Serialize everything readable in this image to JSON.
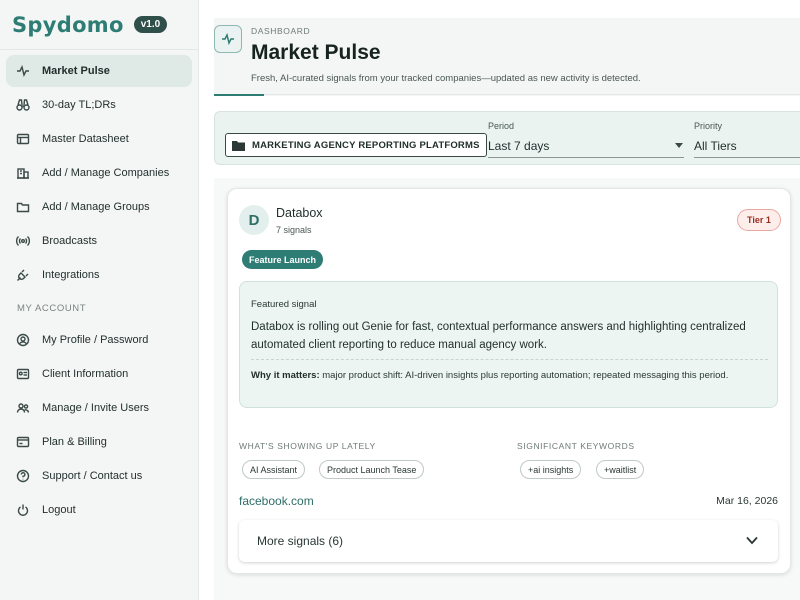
{
  "brand": {
    "name": "Spydomo",
    "version": "v1.0"
  },
  "sidebar": {
    "items": [
      {
        "label": "Market Pulse",
        "icon": "pulse-icon",
        "active": true
      },
      {
        "label": "30-day TL;DRs",
        "icon": "binoculars-icon"
      },
      {
        "label": "Master Datasheet",
        "icon": "table-icon"
      },
      {
        "label": "Add / Manage Companies",
        "icon": "building-icon"
      },
      {
        "label": "Add / Manage Groups",
        "icon": "folder-icon"
      },
      {
        "label": "Broadcasts",
        "icon": "broadcast-icon"
      },
      {
        "label": "Integrations",
        "icon": "plug-icon"
      }
    ],
    "account_heading": "MY ACCOUNT",
    "account_items": [
      {
        "label": "My Profile / Password",
        "icon": "user-circle-icon"
      },
      {
        "label": "Client Information",
        "icon": "id-card-icon"
      },
      {
        "label": "Manage / Invite Users",
        "icon": "users-icon"
      },
      {
        "label": "Plan & Billing",
        "icon": "billing-icon"
      },
      {
        "label": "Support / Contact us",
        "icon": "help-icon"
      },
      {
        "label": "Logout",
        "icon": "power-icon"
      }
    ]
  },
  "header": {
    "eyebrow": "DASHBOARD",
    "title": "Market Pulse",
    "subtitle": "Fresh, AI-curated signals from your tracked companies—updated as new activity is detected."
  },
  "filters": {
    "group": "MARKETING AGENCY REPORTING PLATFORMS",
    "period_label": "Period",
    "period_value": "Last 7 days",
    "priority_label": "Priority",
    "priority_value": "All Tiers"
  },
  "card": {
    "avatar_letter": "D",
    "company": "Databox",
    "signal_count": "7 signals",
    "tier": "Tier 1",
    "tag": "Feature Launch",
    "featured_label": "Featured signal",
    "featured_text": "Databox is rolling out Genie for fast, contextual performance answers and highlighting centralized automated client reporting to reduce manual agency work.",
    "why_label": "Why it matters:",
    "why_text": " major product shift: AI-driven insights plus reporting automation; repeated messaging this period.",
    "showing_heading": "WHAT'S SHOWING UP LATELY",
    "showing_items": [
      "AI Assistant",
      "Product Launch Tease"
    ],
    "keywords_heading": "SIGNIFICANT KEYWORDS",
    "keywords": [
      "+ai insights",
      "+waitlist"
    ],
    "source": "facebook.com",
    "date": "Mar 16, 2026",
    "more_label": "More signals (6)"
  },
  "colors": {
    "accent": "#2e7d74",
    "tier_bg": "#fdeeec",
    "tier_text": "#9a2d22"
  }
}
